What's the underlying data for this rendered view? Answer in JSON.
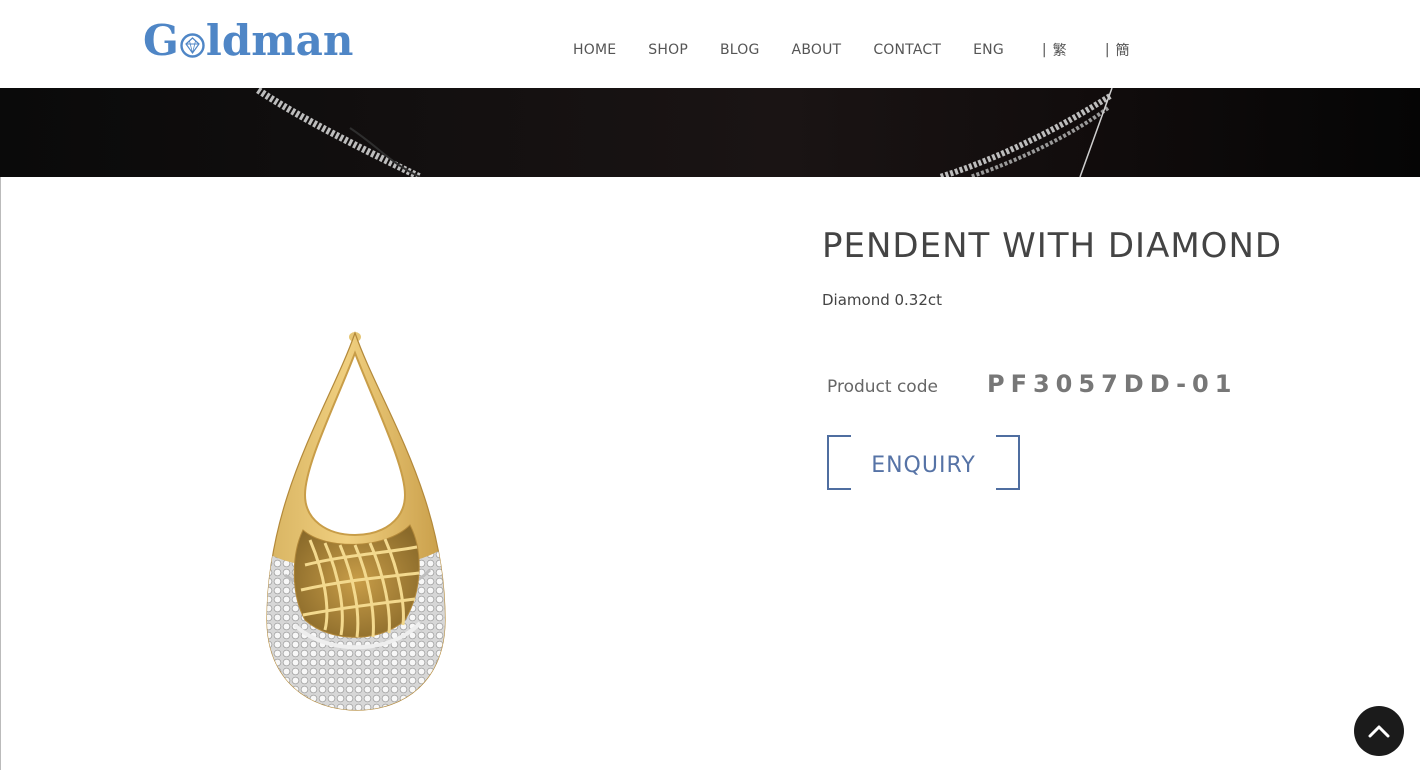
{
  "header": {
    "logo_left": "G",
    "logo_right": "ldman",
    "nav": [
      "HOME",
      "SHOP",
      "BLOG",
      "ABOUT",
      "CONTACT"
    ],
    "languages": [
      "ENG",
      "繁",
      "簡"
    ],
    "language_separator": "|"
  },
  "product": {
    "title": "PENDENT WITH DIAMOND",
    "description": "Diamond 0.32ct",
    "code_label": "Product code",
    "code_value": "PF3057DD-01",
    "enquiry_label": "ENQUIRY"
  },
  "icons": {
    "logo_gem": "diamond-icon",
    "back_to_top": "chevron-up-icon"
  },
  "colors": {
    "brand_blue": "#4f86c6",
    "enquiry_blue": "#5673a6",
    "banner_bg": "#060606",
    "to_top_bg": "#1b1b1b"
  }
}
